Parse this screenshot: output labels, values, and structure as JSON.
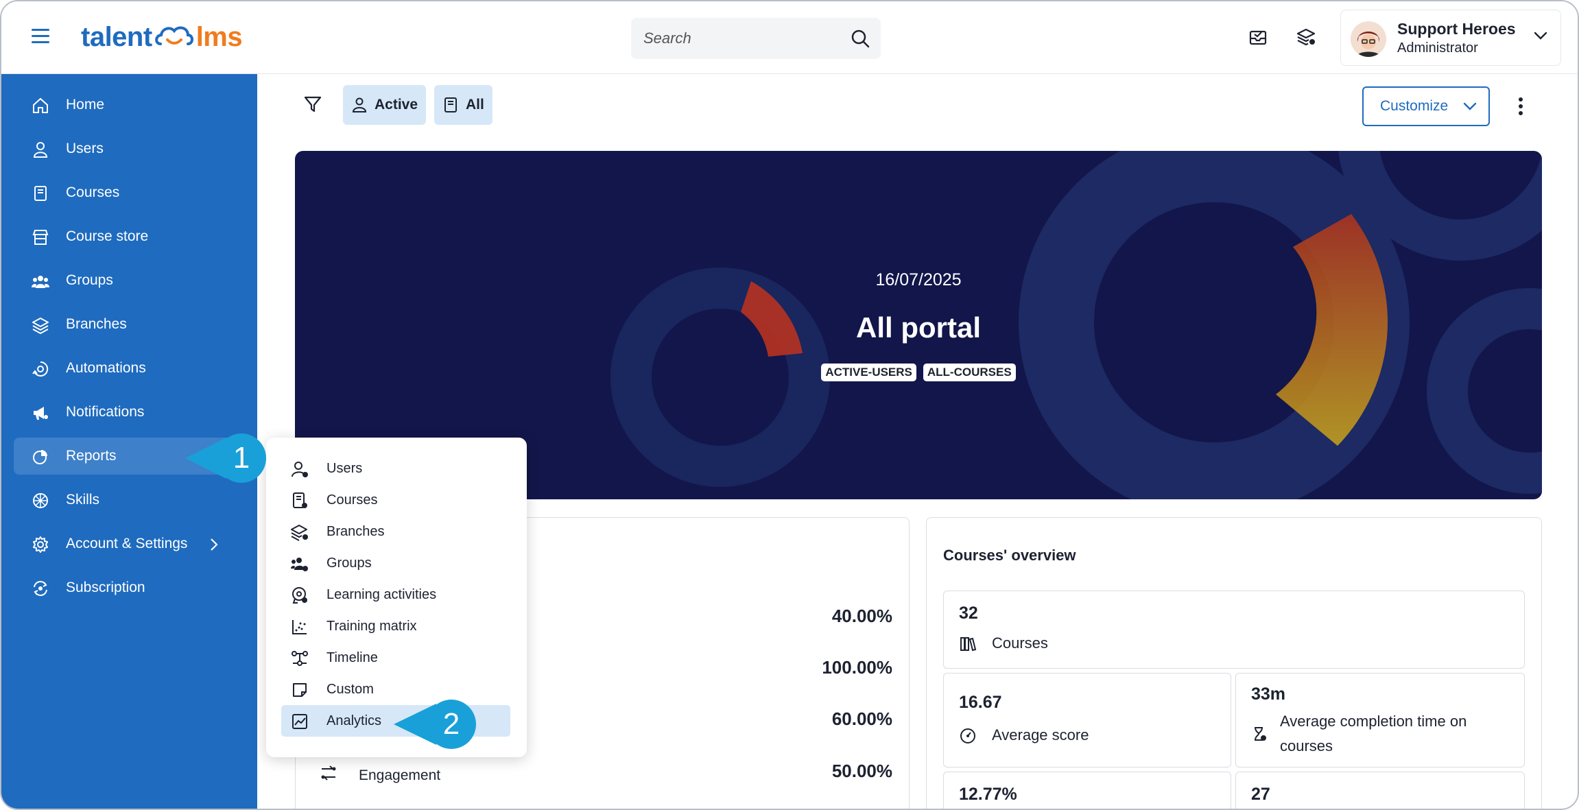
{
  "header": {
    "logo": {
      "part1": "talent",
      "part2": "lms"
    },
    "search_placeholder": "Search",
    "user": {
      "name": "Support Heroes",
      "role": "Administrator"
    }
  },
  "sidebar": {
    "items": [
      {
        "label": "Home",
        "icon": "home-icon"
      },
      {
        "label": "Users",
        "icon": "user-icon"
      },
      {
        "label": "Courses",
        "icon": "book-icon"
      },
      {
        "label": "Course store",
        "icon": "store-icon"
      },
      {
        "label": "Groups",
        "icon": "groups-icon"
      },
      {
        "label": "Branches",
        "icon": "layers-icon"
      },
      {
        "label": "Automations",
        "icon": "automation-icon"
      },
      {
        "label": "Notifications",
        "icon": "megaphone-icon"
      },
      {
        "label": "Reports",
        "icon": "pie-chart-icon"
      },
      {
        "label": "Skills",
        "icon": "skills-icon"
      },
      {
        "label": "Account & Settings",
        "icon": "gear-icon"
      },
      {
        "label": "Subscription",
        "icon": "subscription-icon"
      }
    ]
  },
  "filters": {
    "active_chip": "Active",
    "all_chip": "All",
    "customize": "Customize"
  },
  "banner": {
    "date": "16/07/2025",
    "title": "All portal",
    "tags": [
      "ACTIVE-USERS",
      "ALL-COURSES"
    ]
  },
  "left_card": {
    "values": [
      "40.00%",
      "100.00%",
      "60.00%",
      "50.00%"
    ],
    "engagement_label": "Engagement"
  },
  "courses_overview": {
    "title": "Courses' overview",
    "courses_count": "32",
    "courses_label": "Courses",
    "avg_score": "16.67",
    "avg_score_label": "Average score",
    "avg_time": "33m",
    "avg_time_label": "Average completion time on courses",
    "bottom_left_value": "12.77%",
    "bottom_right_value": "27"
  },
  "reports_menu": {
    "items": [
      {
        "label": "Users",
        "icon": "user-report-icon"
      },
      {
        "label": "Courses",
        "icon": "course-report-icon"
      },
      {
        "label": "Branches",
        "icon": "branch-report-icon"
      },
      {
        "label": "Groups",
        "icon": "group-report-icon"
      },
      {
        "label": "Learning activities",
        "icon": "learning-activities-icon"
      },
      {
        "label": "Training matrix",
        "icon": "training-matrix-icon"
      },
      {
        "label": "Timeline",
        "icon": "timeline-icon"
      },
      {
        "label": "Custom",
        "icon": "custom-report-icon"
      },
      {
        "label": "Analytics",
        "icon": "analytics-icon"
      }
    ]
  },
  "callouts": {
    "first": "1",
    "second": "2"
  },
  "colors": {
    "brand_blue": "#1f6bbf",
    "brand_orange": "#f07c1e",
    "banner_bg": "#12164a",
    "callout": "#19a0d8",
    "highlight": "#d6e7f7"
  }
}
